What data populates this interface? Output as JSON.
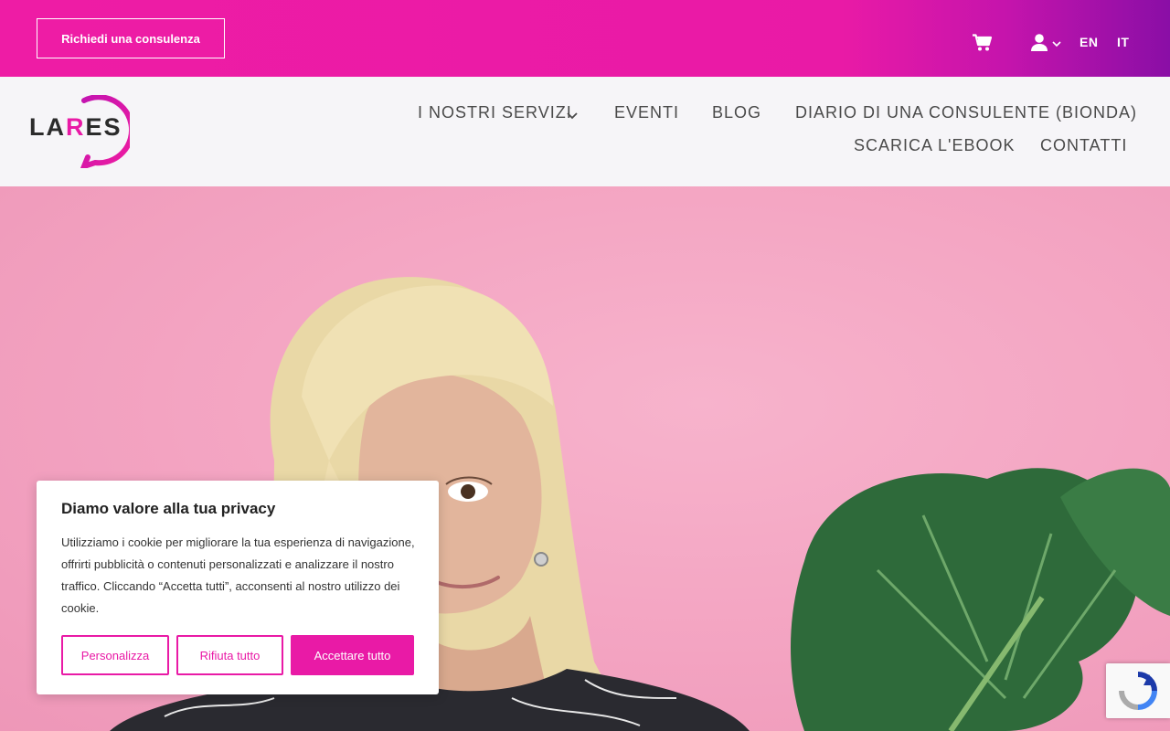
{
  "topbar": {
    "cta_label": "Richiedi una consulenza",
    "cart_icon": "cart-icon",
    "user_icon": "user-icon",
    "languages": [
      "EN",
      "IT"
    ]
  },
  "header": {
    "logo_text_a": "LA",
    "logo_text_r": "R",
    "logo_text_b": "ES",
    "nav": {
      "services": "I NOSTRI SERVIZI",
      "events": "EVENTI",
      "blog": "BLOG",
      "diary": "DIARIO DI UNA CONSULENTE (BIONDA)",
      "ebook": "SCARICA L'EBOOK",
      "contacts": "CONTATTI"
    }
  },
  "cookie": {
    "title": "Diamo valore alla tua privacy",
    "text": "Utilizziamo i cookie per migliorare la tua esperienza di navigazione, offrirti pubblicità o contenuti personalizzati e analizzare il nostro traffico. Cliccando “Accetta tutti”, acconsenti al nostro utilizzo dei cookie.",
    "personalize_label": "Personalizza",
    "reject_label": "Rifiuta tutto",
    "accept_label": "Accettare tutto"
  },
  "colors": {
    "brand_pink": "#e91aa6",
    "brand_purple": "#8a0ea6",
    "hero_bg": "#f4a7c6"
  }
}
